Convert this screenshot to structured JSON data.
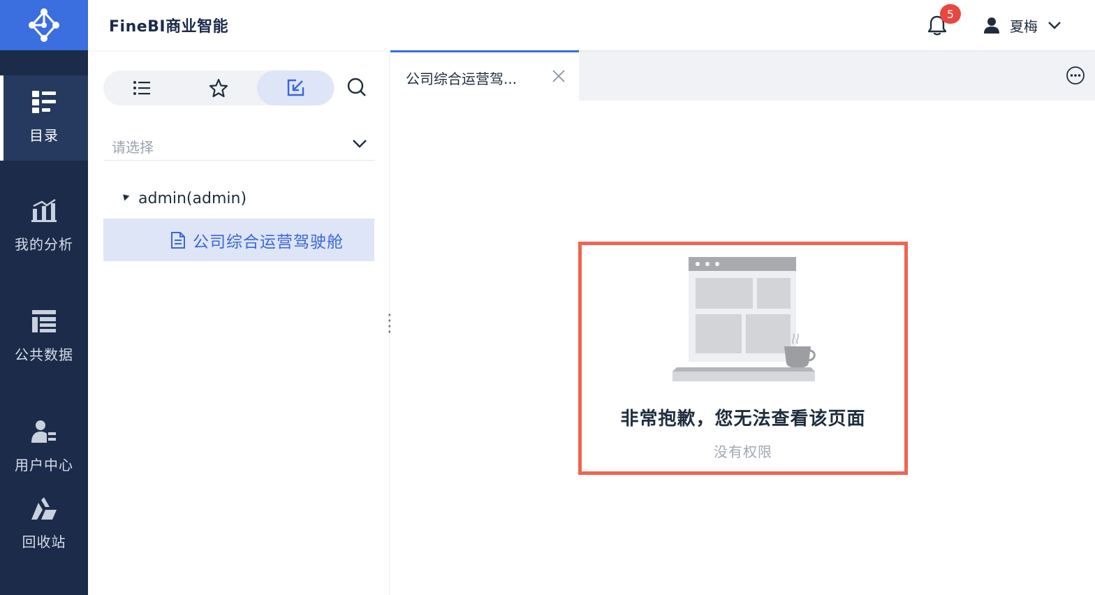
{
  "app": {
    "title": "FineBI商业智能"
  },
  "header": {
    "notifications": {
      "count": "5",
      "icon": "bell-icon"
    },
    "user": {
      "name": "夏梅",
      "icon": "user-icon"
    }
  },
  "nav": {
    "items": [
      {
        "label": "目录",
        "icon": "catalog-icon",
        "active": true
      },
      {
        "label": "我的分析",
        "icon": "analysis-chart-icon",
        "active": false
      },
      {
        "label": "公共数据",
        "icon": "public-data-icon",
        "active": false
      },
      {
        "label": "用户中心",
        "icon": "user-center-icon",
        "active": false
      },
      {
        "label": "回收站",
        "icon": "recycle-icon",
        "active": false
      }
    ]
  },
  "panel": {
    "views": [
      {
        "icon": "list-icon",
        "active": false
      },
      {
        "icon": "star-icon",
        "active": false
      },
      {
        "icon": "edit-square-icon",
        "active": true
      }
    ],
    "select": {
      "placeholder": "请选择"
    },
    "tree": {
      "root": "admin(admin)",
      "children": [
        {
          "label": "公司综合运营驾驶舱",
          "selected": true
        }
      ]
    }
  },
  "tabs": [
    {
      "label": "公司综合运营驾...",
      "active": true
    }
  ],
  "notice": {
    "title": "非常抱歉，您无法查看该页面",
    "subtitle": "没有权限"
  },
  "colors": {
    "rail_bg": "#1c2b4a",
    "brand_blue": "#3b6fe0",
    "selected_bg": "#dde5f7",
    "badge_red": "#e8473f",
    "highlight_border": "#f06450"
  }
}
